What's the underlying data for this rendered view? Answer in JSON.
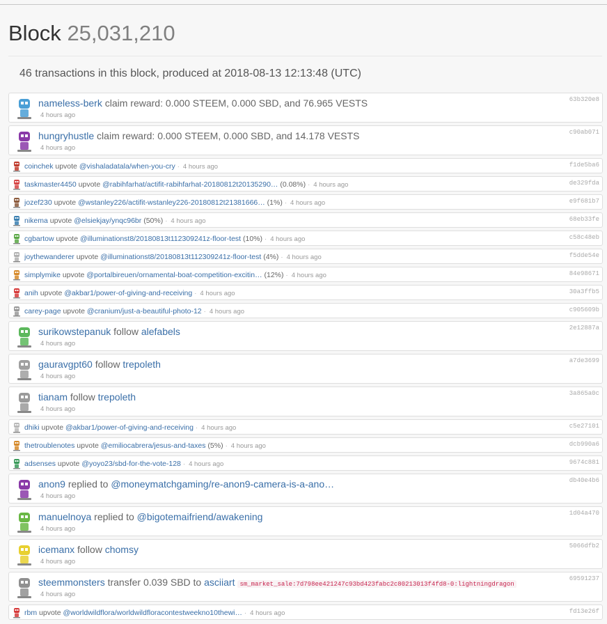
{
  "block": {
    "title": "Block",
    "number": "25,031,210"
  },
  "summary": "46 transactions in this block, produced at 2018-08-13 12:13:48 (UTC)",
  "transactions": [
    {
      "size": "large",
      "avatar_color": "#4a9fd6",
      "user": "nameless-berk",
      "action": "claim reward: 0.000 STEEM, 0.000 SBD, and 76.965 VESTS",
      "target": "",
      "extra": "",
      "time": "4 hours ago",
      "hash": "63b320e8"
    },
    {
      "size": "large",
      "avatar_color": "#8a3aa8",
      "user": "hungryhustle",
      "action": "claim reward: 0.000 STEEM, 0.000 SBD, and 14.178 VESTS",
      "target": "",
      "extra": "",
      "time": "4 hours ago",
      "hash": "c90ab071"
    },
    {
      "size": "small",
      "avatar_color": "#c0392b",
      "user": "coinchek",
      "action": "upvote",
      "target": "@vishaladatala/when-you-cry",
      "extra": "",
      "time": "4 hours ago",
      "hash": "f1de5ba6"
    },
    {
      "size": "small",
      "avatar_color": "#d64545",
      "user": "taskmaster4450",
      "action": "upvote",
      "target": "@rabihfarhat/actifit-rabihfarhat-20180812t20135290…",
      "extra": "(0.08%)",
      "time": "4 hours ago",
      "hash": "de329fda"
    },
    {
      "size": "small",
      "avatar_color": "#8b5a3c",
      "user": "jozef230",
      "action": "upvote",
      "target": "@wstanley226/actifit-wstanley226-20180812t21381666…",
      "extra": "(1%)",
      "time": "4 hours ago",
      "hash": "e9f681b7"
    },
    {
      "size": "small",
      "avatar_color": "#3a7fb0",
      "user": "nikema",
      "action": "upvote",
      "target": "@elsiekjay/ynqc96br",
      "extra": "(50%)",
      "time": "4 hours ago",
      "hash": "68eb33fe"
    },
    {
      "size": "small",
      "avatar_color": "#5aa845",
      "user": "cgbartow",
      "action": "upvote",
      "target": "@illuminationst8/20180813t112309241z-floor-test",
      "extra": "(10%)",
      "time": "4 hours ago",
      "hash": "c58c48eb"
    },
    {
      "size": "small",
      "avatar_color": "#b0b0b0",
      "user": "joythewanderer",
      "action": "upvote",
      "target": "@illuminationst8/20180813t112309241z-floor-test",
      "extra": "(4%)",
      "time": "4 hours ago",
      "hash": "f5dde54e"
    },
    {
      "size": "small",
      "avatar_color": "#d68a2a",
      "user": "simplymike",
      "action": "upvote",
      "target": "@portalbireuen/ornamental-boat-competition-excitin…",
      "extra": "(12%)",
      "time": "4 hours ago",
      "hash": "84e98671"
    },
    {
      "size": "small",
      "avatar_color": "#d63a3a",
      "user": "anih",
      "action": "upvote",
      "target": "@akbar1/power-of-giving-and-receiving",
      "extra": "",
      "time": "4 hours ago",
      "hash": "30a3ffb5"
    },
    {
      "size": "small",
      "avatar_color": "#999999",
      "user": "carey-page",
      "action": "upvote",
      "target": "@cranium/just-a-beautiful-photo-12",
      "extra": "",
      "time": "4 hours ago",
      "hash": "c905609b"
    },
    {
      "size": "large",
      "avatar_color": "#5cb85c",
      "user": "surikowstepanuk",
      "action": "follow",
      "target": "alefabels",
      "extra": "",
      "time": "4 hours ago",
      "hash": "2e12887a"
    },
    {
      "size": "large",
      "avatar_color": "#a0a0a0",
      "user": "gauravgpt60",
      "action": "follow",
      "target": "trepoleth",
      "extra": "",
      "time": "4 hours ago",
      "hash": "a7de3699"
    },
    {
      "size": "large",
      "avatar_color": "#9a9a9a",
      "user": "tianam",
      "action": "follow",
      "target": "trepoleth",
      "extra": "",
      "time": "4 hours ago",
      "hash": "3a865a0c"
    },
    {
      "size": "small",
      "avatar_color": "#b8b8b8",
      "user": "dhiki",
      "action": "upvote",
      "target": "@akbar1/power-of-giving-and-receiving",
      "extra": "",
      "time": "4 hours ago",
      "hash": "c5e27101"
    },
    {
      "size": "small",
      "avatar_color": "#d68a2a",
      "user": "thetroublenotes",
      "action": "upvote",
      "target": "@emiliocabrera/jesus-and-taxes",
      "extra": "(5%)",
      "time": "4 hours ago",
      "hash": "dcb990a6"
    },
    {
      "size": "small",
      "avatar_color": "#3a9a5a",
      "user": "adsenses",
      "action": "upvote",
      "target": "@yoyo23/sbd-for-the-vote-128",
      "extra": "",
      "time": "4 hours ago",
      "hash": "9674c881"
    },
    {
      "size": "large",
      "avatar_color": "#8a3aa8",
      "user": "anon9",
      "action": "replied to",
      "target": "@moneymatchgaming/re-anon9-camera-is-a-ano…",
      "extra": "",
      "time": "4 hours ago",
      "hash": "db40e4b6"
    },
    {
      "size": "large",
      "avatar_color": "#6ab845",
      "user": "manuelnoya",
      "action": "replied to",
      "target": "@bigotemaifriend/awakening",
      "extra": "",
      "time": "4 hours ago",
      "hash": "1d04a470"
    },
    {
      "size": "large",
      "avatar_color": "#e8d030",
      "user": "icemanx",
      "action": "follow",
      "target": "chomsy",
      "extra": "",
      "time": "4 hours ago",
      "hash": "5066dfb2"
    },
    {
      "size": "large",
      "avatar_color": "#909090",
      "user": "steemmonsters",
      "action": "transfer 0.039 SBD to",
      "target": "asciiart",
      "extra": "",
      "memo": "sm_market_sale:7d798ee421247c93bd423fabc2c80213013f4fd8-0:lightningdragon",
      "time": "4 hours ago",
      "hash": "69591237"
    },
    {
      "size": "small",
      "avatar_color": "#d63a3a",
      "user": "rbm",
      "action": "upvote",
      "target": "@worldwildflora/worldwildfloracontestweekno10thewi…",
      "extra": "",
      "time": "4 hours ago",
      "hash": "fd13e26f"
    }
  ]
}
